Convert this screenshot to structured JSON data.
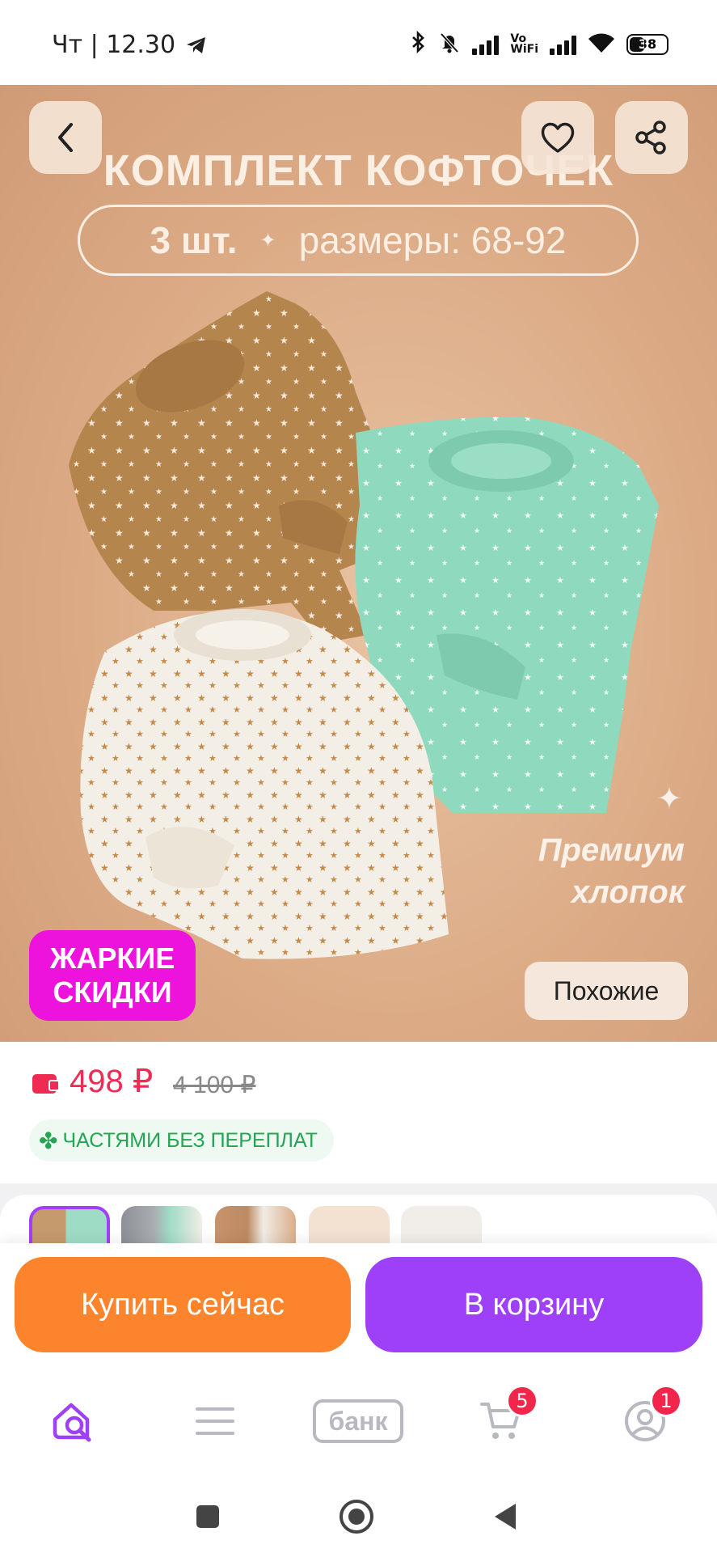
{
  "status_bar": {
    "time": "Чт | 12.30",
    "vowifi_line1": "Vo",
    "vowifi_line2": "WiFi",
    "battery": "38"
  },
  "hero": {
    "title": "КОМПЛЕКТ КОФТОЧЕК",
    "quantity": "3 шт.",
    "sizes": "размеры: 68-92",
    "premium_line1": "Премиум",
    "premium_line2": "хлопок",
    "hot_line1": "ЖАРКИЕ",
    "hot_line2": "СКИДКИ",
    "similar_label": "Похожие"
  },
  "price": {
    "current": "498 ₽",
    "old": "4 100 ₽",
    "installments": "ЧАСТЯМИ БЕЗ ПЕРЕПЛАТ"
  },
  "actions": {
    "buy_now": "Купить сейчас",
    "add_to_cart": "В корзину"
  },
  "bottom_nav": {
    "bank_label": "банк",
    "cart_badge": "5",
    "profile_badge": "1"
  },
  "colors": {
    "price": "#ef2b54",
    "buy_button": "#fb842c",
    "cart_button": "#9d40f8",
    "hot_badge": "#ee12dd",
    "installments": "#26a454"
  }
}
